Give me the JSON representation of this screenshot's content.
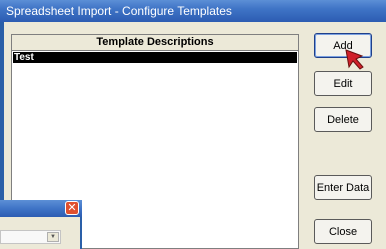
{
  "window": {
    "title": "Spreadsheet Import - Configure Templates"
  },
  "list": {
    "header": "Template Descriptions",
    "rows": [
      "Test"
    ],
    "selected_row": "Test"
  },
  "buttons": {
    "add": "Add",
    "edit": "Edit",
    "delete": "Delete",
    "enter_data": "Enter Data",
    "close": "Close"
  },
  "colors": {
    "titlebar": "#3f74c6",
    "selection": "#000000",
    "accent_cursor": "#d0202a"
  },
  "icons": {
    "cursor": "red-arrow-cursor",
    "close": "close-icon",
    "dropdown": "chevron-down-icon"
  }
}
